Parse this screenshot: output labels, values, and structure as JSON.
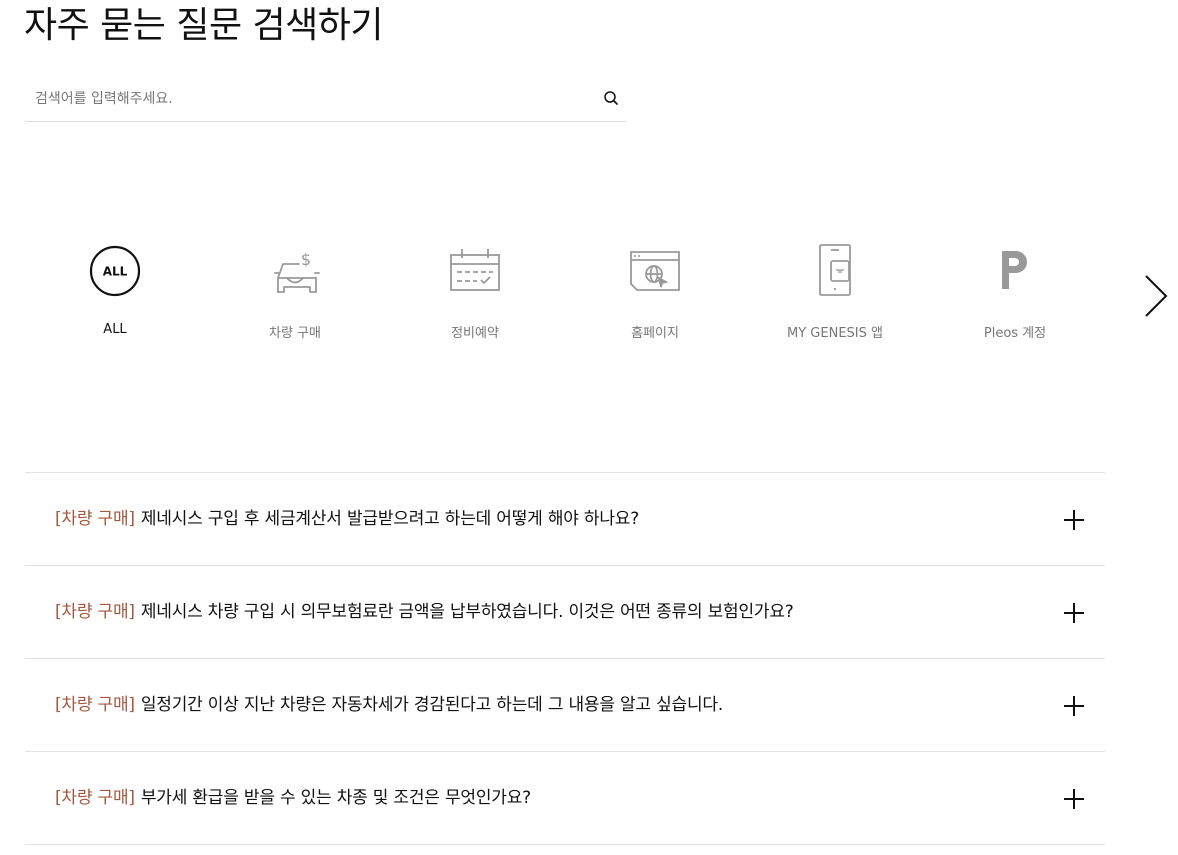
{
  "page": {
    "title": "자주 묻는 질문 검색하기"
  },
  "search": {
    "placeholder": "검색어를 입력해주세요.",
    "value": "",
    "icon": "search-icon"
  },
  "categories": {
    "items": [
      {
        "label": "ALL",
        "icon_text": "ALL",
        "icon": "all-icon",
        "active": true
      },
      {
        "label": "차량 구매",
        "icon": "car-purchase-icon",
        "active": false
      },
      {
        "label": "정비예약",
        "icon": "calendar-icon",
        "active": false
      },
      {
        "label": "홈페이지",
        "icon": "browser-globe-icon",
        "active": false
      },
      {
        "label": "MY GENESIS 앱",
        "icon": "phone-app-icon",
        "active": false
      },
      {
        "label": "Pleos 계정",
        "icon": "pleos-logo-icon",
        "active": false
      }
    ],
    "next_icon": "chevron-right-icon"
  },
  "faq": {
    "items": [
      {
        "category": "[차량 구매]",
        "question": "제네시스 구입 후 세금계산서 발급받으려고 하는데 어떻게 해야 하나요?"
      },
      {
        "category": "[차량 구매]",
        "question": "제네시스 차량 구입 시 의무보험료란 금액을 납부하였습니다. 이것은 어떤 종류의 보험인가요?"
      },
      {
        "category": "[차량 구매]",
        "question": "일정기간 이상 지난 차량은 자동차세가 경감된다고 하는데 그 내용을 알고 싶습니다."
      },
      {
        "category": "[차량 구매]",
        "question": "부가세 환급을 받을 수 있는 차종 및 조건은 무엇인가요?"
      }
    ],
    "expand_icon": "plus-icon"
  },
  "colors": {
    "accent": "#a3593f",
    "text": "#111111",
    "muted": "#777777",
    "icon_gray": "#999999",
    "divider": "#e3e3e3"
  }
}
